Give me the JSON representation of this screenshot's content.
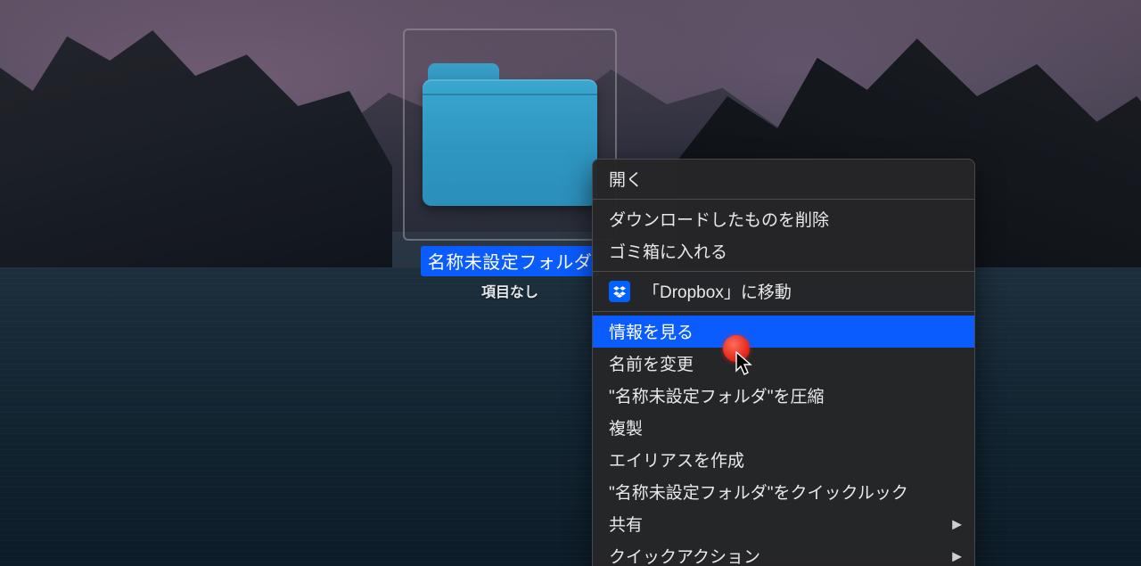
{
  "folder": {
    "name": "名称未設定フォルダ",
    "subtitle": "項目なし"
  },
  "menu": {
    "open": "開く",
    "remove_download": "ダウンロードしたものを削除",
    "trash": "ゴミ箱に入れる",
    "move_to_dropbox": "「Dropbox」に移動",
    "get_info": "情報を見る",
    "rename": "名前を変更",
    "compress": "\"名称未設定フォルダ\"を圧縮",
    "duplicate": "複製",
    "make_alias": "エイリアスを作成",
    "quick_look": "\"名称未設定フォルダ\"をクイックルック",
    "share": "共有",
    "quick_actions": "クイックアクション"
  },
  "icons": {
    "dropbox": "dropbox-icon"
  },
  "colors": {
    "highlight": "#0a5cff",
    "menu_bg": "#262628",
    "folder_blue": "#2f97c2"
  }
}
